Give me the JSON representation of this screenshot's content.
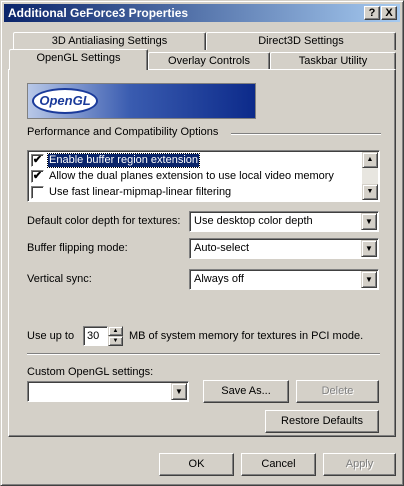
{
  "window": {
    "title": "Additional GeForce3 Properties",
    "help_glyph": "?",
    "close_glyph": "X"
  },
  "tabs": {
    "row_back": [
      "3D Antialiasing Settings",
      "Direct3D Settings"
    ],
    "row_front": [
      "OpenGL Settings",
      "Overlay Controls",
      "Taskbar Utility"
    ],
    "active": "OpenGL Settings"
  },
  "banner": {
    "logo_text": "OpenGL"
  },
  "performance": {
    "label": "Performance and Compatibility Options",
    "items": [
      {
        "label": "Enable buffer region extension",
        "checked": true,
        "selected": true
      },
      {
        "label": "Allow the dual planes extension to use local video memory",
        "checked": true,
        "selected": false
      },
      {
        "label": "Use fast linear-mipmap-linear filtering",
        "checked": false,
        "selected": false
      }
    ]
  },
  "settings": {
    "color_depth": {
      "label": "Default color depth for textures:",
      "value": "Use desktop color depth"
    },
    "buffer_flipping": {
      "label": "Buffer flipping mode:",
      "value": "Auto-select"
    },
    "vsync": {
      "label": "Vertical sync:",
      "value": "Always off"
    }
  },
  "memory": {
    "prefix": "Use up to",
    "value": "30",
    "suffix": "MB of system memory for textures in PCI mode."
  },
  "custom": {
    "label": "Custom OpenGL settings:",
    "value": "",
    "save_as": "Save As...",
    "delete": "Delete",
    "restore": "Restore Defaults"
  },
  "footer": {
    "ok": "OK",
    "cancel": "Cancel",
    "apply": "Apply"
  }
}
